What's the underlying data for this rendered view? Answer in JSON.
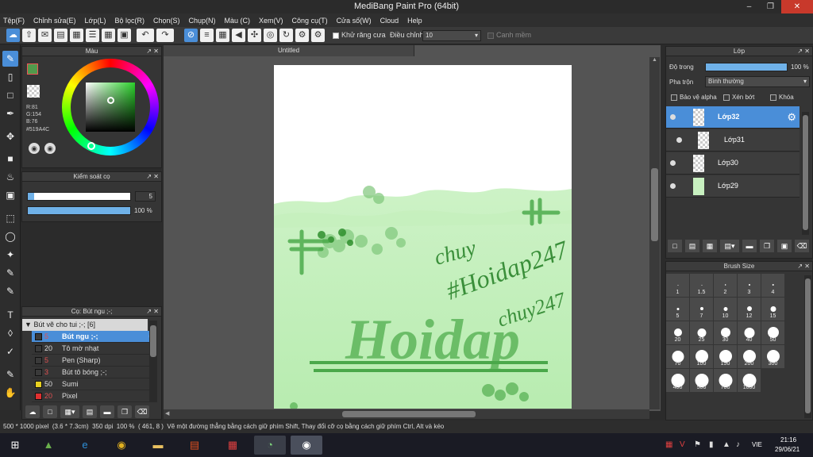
{
  "window": {
    "title": "MediBang Paint Pro (64bit)"
  },
  "menu": [
    "Tệp(F)",
    "Chỉnh sửa(E)",
    "Lớp(L)",
    "Bộ lọc(R)",
    "Chọn(S)",
    "Chụp(N)",
    "Màu (C)",
    "Xem(V)",
    "Công cụ(T)",
    "Cửa số(W)",
    "Cloud",
    "Help"
  ],
  "toolbar": {
    "antialias_label": "Khử răng cưa",
    "correction_label": "Điều chỉnh",
    "correction_value": "10",
    "snap_label": "Canh mềm"
  },
  "color_panel": {
    "title": "Màu",
    "r": "R:81",
    "g": "G:154",
    "b": "B:76",
    "hex": "#519A4C",
    "fg_color": "#519A4C"
  },
  "brush_control": {
    "title": "Kiểm soát cọ",
    "size_value": "5",
    "opacity_value": "100 %",
    "size_fraction": 0.05,
    "opacity_fraction": 1.0
  },
  "brush_list": {
    "title": "Cọ: Bút ngu ;-;",
    "group": "Bút vẽ cho tui ;-; [6]",
    "items": [
      {
        "size": "5",
        "name": "Bút ngu ;-;",
        "color": "#3a3a3a",
        "size_color": "#e05050",
        "selected": true
      },
      {
        "size": "20",
        "name": "Tô mờ nhạt",
        "color": "#3a3a3a",
        "size_color": "#dddddd"
      },
      {
        "size": "5",
        "name": "Pen (Sharp)",
        "color": "#3a3a3a",
        "size_color": "#e05050"
      },
      {
        "size": "3",
        "name": "Bút tô bóng ;-;",
        "color": "#3a3a3a",
        "size_color": "#e05050"
      },
      {
        "size": "50",
        "name": "Sumi",
        "color": "#e8d020",
        "size_color": "#dddddd"
      },
      {
        "size": "20",
        "name": "Pixel",
        "color": "#e03030",
        "size_color": "#e05050"
      }
    ]
  },
  "document": {
    "tab": "Untitled"
  },
  "layer_panel": {
    "title": "Lớp",
    "opacity_label": "Độ trong",
    "opacity_value": "100 %",
    "blend_label": "Pha trộn",
    "blend_value": "Bình thường",
    "protect_alpha": "Bảo vệ alpha",
    "clipping": "Xén bớt",
    "lock": "Khóa",
    "layers": [
      {
        "name": "Lớp32",
        "selected": true,
        "indent": false
      },
      {
        "name": "Lớp31",
        "selected": false,
        "indent": true
      },
      {
        "name": "Lớp30",
        "selected": false,
        "indent": false
      },
      {
        "name": "Lớp29",
        "selected": false,
        "indent": false
      }
    ]
  },
  "brush_size_panel": {
    "title": "Brush Size",
    "sizes": [
      "1",
      "1.5",
      "2",
      "3",
      "4",
      "5",
      "7",
      "10",
      "12",
      "15",
      "20",
      "25",
      "30",
      "40",
      "50",
      "70",
      "100",
      "150",
      "200",
      "300",
      "400",
      "500",
      "700",
      "1000"
    ]
  },
  "status": {
    "dimensions": "500 * 1000 pixel",
    "physical": "(3.6 * 7.3cm)",
    "dpi": "350 dpi",
    "zoom": "100 %",
    "coords": "( 461, 8 )",
    "hint": "Vẽ một đường thẳng bằng cách giữ phím Shift, Thay đổi cỡ cọ bằng cách giữ phím Ctrl, Alt và kéo"
  },
  "canvas_art": {
    "signature1": "chuy",
    "signature2": "#Hoidap247",
    "signature3": "chuy247",
    "big_text": "Hoidap"
  },
  "taskbar": {
    "language": "VIE",
    "time": "21:16",
    "date": "29/06/21"
  }
}
